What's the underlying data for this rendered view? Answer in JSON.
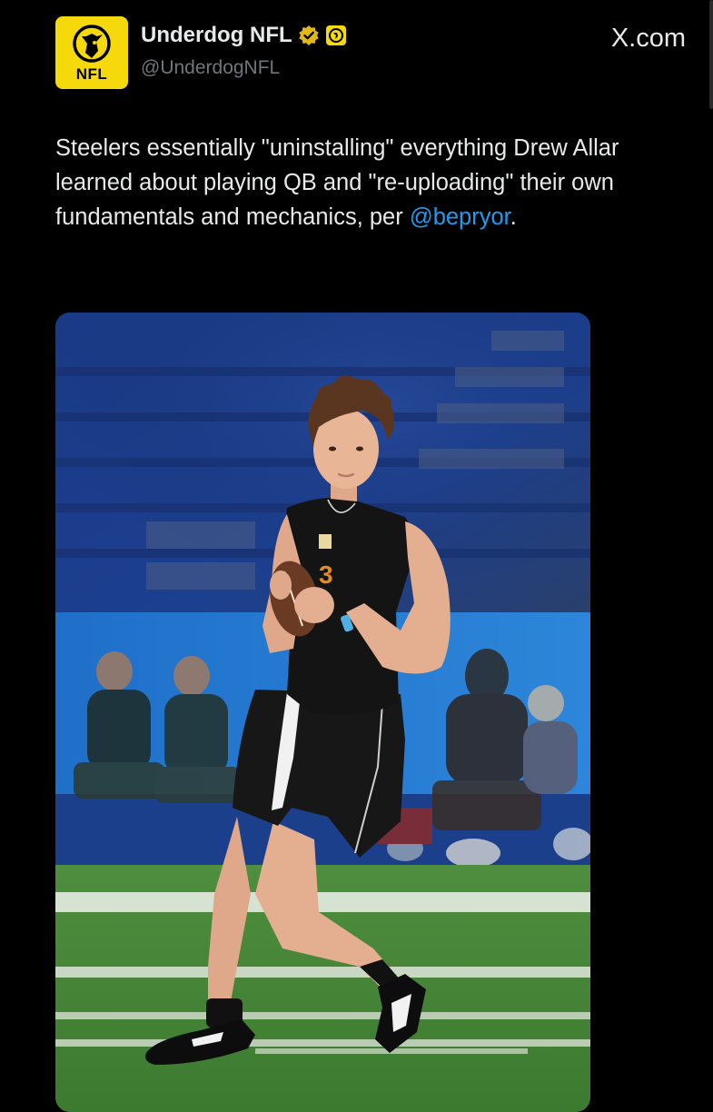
{
  "post": {
    "avatar": {
      "icon": "dog-head-icon",
      "label": "NFL",
      "background": "#f5d90a"
    },
    "author": {
      "display_name": "Underdog NFL",
      "handle": "@UnderdogNFL",
      "verified_badge": "verified-gold-badge-icon",
      "affiliate_badge": "underdog-affiliate-icon"
    },
    "source_label": "X.com",
    "text": {
      "body": "Steelers essentially \"uninstalling\" everything Drew Allar learned about playing QB and \"re-uploading\" their own fundamentals and mechanics, per ",
      "mention": "@bepryor",
      "trailing": "."
    },
    "media": {
      "type": "photo",
      "description_icon": "quarterback-photo"
    },
    "colors": {
      "background": "#000000",
      "text": "#e7e9ea",
      "secondary": "#71767b",
      "link": "#1d9bf0",
      "verified": "#e2b719"
    }
  }
}
